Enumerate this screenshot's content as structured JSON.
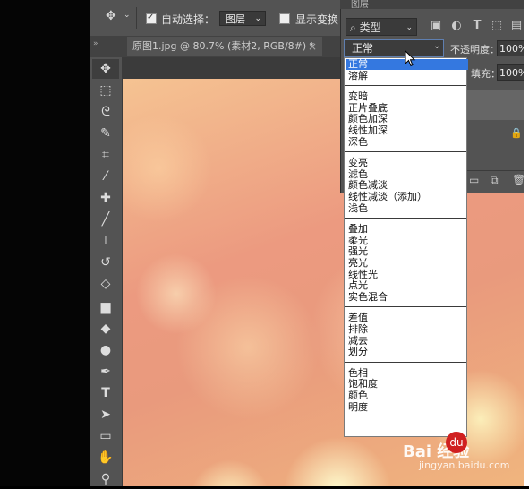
{
  "options_bar": {
    "auto_select_label": "自动选择：",
    "auto_select_target": "图层",
    "show_transform_label": "显示变换"
  },
  "document_tab": {
    "title": "原图1.jpg @ 80.7% (素材2, RGB/8#) *",
    "close_glyph": "×"
  },
  "layers_panel": {
    "title": "图层",
    "filter_type": "类型",
    "blend_mode_current": "正常",
    "opacity_label": "不透明度：",
    "opacity_value": "100%",
    "fill_label": "填充：",
    "fill_value": "100%"
  },
  "blend_menu": {
    "groups": [
      [
        "正常",
        "溶解"
      ],
      [
        "变暗",
        "正片叠底",
        "颜色加深",
        "线性加深",
        "深色"
      ],
      [
        "变亮",
        "滤色",
        "颜色减淡",
        "线性减淡（添加）",
        "浅色"
      ],
      [
        "叠加",
        "柔光",
        "强光",
        "亮光",
        "线性光",
        "点光",
        "实色混合"
      ],
      [
        "差值",
        "排除",
        "减去",
        "划分"
      ],
      [
        "色相",
        "饱和度",
        "颜色",
        "明度"
      ]
    ],
    "selected": "正常"
  },
  "watermark": {
    "text": "Bai 经验",
    "paw": "du",
    "url": "jingyan.baidu.com"
  },
  "colors": {
    "panel": "#535353",
    "menu_highlight": "#3478e0"
  }
}
